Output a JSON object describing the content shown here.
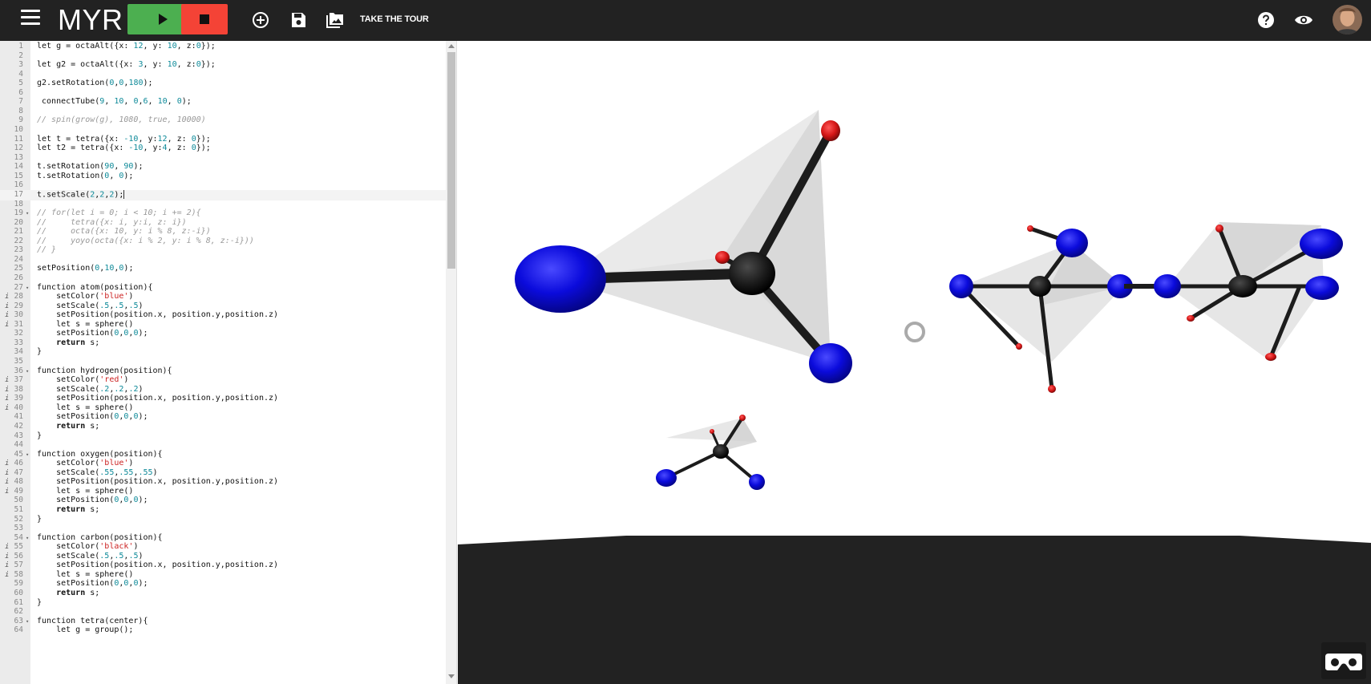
{
  "header": {
    "logo": "MYR",
    "tour_label": "TAKE THE TOUR",
    "icons": [
      "menu-icon",
      "play-icon",
      "stop-icon",
      "add-circle-icon",
      "save-icon",
      "collection-icon",
      "help-icon",
      "eye-icon",
      "avatar"
    ]
  },
  "editor": {
    "lines": [
      {
        "n": "1",
        "ann": "",
        "fold": "",
        "tokens": [
          [
            "let g = octaAlt({x: ",
            ""
          ],
          [
            "12",
            "num"
          ],
          [
            ", y: ",
            ""
          ],
          [
            "10",
            "num"
          ],
          [
            ", z:",
            ""
          ],
          [
            "0",
            "num"
          ],
          [
            "});",
            ""
          ]
        ]
      },
      {
        "n": "2",
        "ann": "",
        "fold": "",
        "tokens": []
      },
      {
        "n": "3",
        "ann": "",
        "fold": "",
        "tokens": [
          [
            "let g2 = octaAlt({x: ",
            ""
          ],
          [
            "3",
            "num"
          ],
          [
            ", y: ",
            ""
          ],
          [
            "10",
            "num"
          ],
          [
            ", z:",
            ""
          ],
          [
            "0",
            "num"
          ],
          [
            "});",
            ""
          ]
        ]
      },
      {
        "n": "4",
        "ann": "",
        "fold": "",
        "tokens": []
      },
      {
        "n": "5",
        "ann": "",
        "fold": "",
        "tokens": [
          [
            "g2.setRotation(",
            ""
          ],
          [
            "0",
            "num"
          ],
          [
            ",",
            ""
          ],
          [
            "0",
            "num"
          ],
          [
            ",",
            ""
          ],
          [
            "180",
            "num"
          ],
          [
            ");",
            ""
          ]
        ]
      },
      {
        "n": "6",
        "ann": "",
        "fold": "",
        "tokens": []
      },
      {
        "n": "7",
        "ann": "",
        "fold": "",
        "tokens": [
          [
            " connectTube(",
            ""
          ],
          [
            "9",
            "num"
          ],
          [
            ", ",
            ""
          ],
          [
            "10",
            "num"
          ],
          [
            ", ",
            ""
          ],
          [
            "0",
            "num"
          ],
          [
            ",",
            ""
          ],
          [
            "6",
            "num"
          ],
          [
            ", ",
            ""
          ],
          [
            "10",
            "num"
          ],
          [
            ", ",
            ""
          ],
          [
            "0",
            "num"
          ],
          [
            ");",
            ""
          ]
        ]
      },
      {
        "n": "8",
        "ann": "",
        "fold": "",
        "tokens": []
      },
      {
        "n": "9",
        "ann": "",
        "fold": "",
        "tokens": [
          [
            "// spin(grow(g), 1080, true, 10000)",
            "com"
          ]
        ]
      },
      {
        "n": "10",
        "ann": "",
        "fold": "",
        "tokens": []
      },
      {
        "n": "11",
        "ann": "",
        "fold": "",
        "tokens": [
          [
            "let t = tetra({x: ",
            ""
          ],
          [
            "-10",
            "num"
          ],
          [
            ", y:",
            ""
          ],
          [
            "12",
            "num"
          ],
          [
            ", z: ",
            ""
          ],
          [
            "0",
            "num"
          ],
          [
            "});",
            ""
          ]
        ]
      },
      {
        "n": "12",
        "ann": "",
        "fold": "",
        "tokens": [
          [
            "let t2 = tetra({x: ",
            ""
          ],
          [
            "-10",
            "num"
          ],
          [
            ", y:",
            ""
          ],
          [
            "4",
            "num"
          ],
          [
            ", z: ",
            ""
          ],
          [
            "0",
            "num"
          ],
          [
            "});",
            ""
          ]
        ]
      },
      {
        "n": "13",
        "ann": "",
        "fold": "",
        "tokens": []
      },
      {
        "n": "14",
        "ann": "",
        "fold": "",
        "tokens": [
          [
            "t.setRotation(",
            ""
          ],
          [
            "90",
            "num"
          ],
          [
            ", ",
            ""
          ],
          [
            "90",
            "num"
          ],
          [
            ");",
            ""
          ]
        ]
      },
      {
        "n": "15",
        "ann": "",
        "fold": "",
        "tokens": [
          [
            "t.setRotation(",
            ""
          ],
          [
            "0",
            "num"
          ],
          [
            ", ",
            ""
          ],
          [
            "0",
            "num"
          ],
          [
            ");",
            ""
          ]
        ]
      },
      {
        "n": "16",
        "ann": "",
        "fold": "",
        "tokens": []
      },
      {
        "n": "17",
        "ann": "",
        "fold": "",
        "active": true,
        "tokens": [
          [
            "t.setScale(",
            ""
          ],
          [
            "2",
            "num"
          ],
          [
            ",",
            ""
          ],
          [
            "2",
            "num"
          ],
          [
            ",",
            ""
          ],
          [
            "2",
            "num"
          ],
          [
            ");",
            ""
          ]
        ]
      },
      {
        "n": "18",
        "ann": "",
        "fold": "",
        "tokens": []
      },
      {
        "n": "19",
        "ann": "",
        "fold": "▾",
        "tokens": [
          [
            "// for(let i = 0; i < 10; i += 2){",
            "com"
          ]
        ]
      },
      {
        "n": "20",
        "ann": "",
        "fold": "",
        "tokens": [
          [
            "//     tetra({x: i, y:i, z: i})",
            "com"
          ]
        ]
      },
      {
        "n": "21",
        "ann": "",
        "fold": "",
        "tokens": [
          [
            "//     octa({x: 10, y: i % 8, z:-i})",
            "com"
          ]
        ]
      },
      {
        "n": "22",
        "ann": "",
        "fold": "",
        "tokens": [
          [
            "//     yoyo(octa({x: i % 2, y: i % 8, z:-i}))",
            "com"
          ]
        ]
      },
      {
        "n": "23",
        "ann": "",
        "fold": "",
        "tokens": [
          [
            "// }",
            "com"
          ]
        ]
      },
      {
        "n": "24",
        "ann": "",
        "fold": "",
        "tokens": []
      },
      {
        "n": "25",
        "ann": "",
        "fold": "",
        "tokens": [
          [
            "setPosition(",
            ""
          ],
          [
            "0",
            "num"
          ],
          [
            ",",
            ""
          ],
          [
            "10",
            "num"
          ],
          [
            ",",
            ""
          ],
          [
            "0",
            "num"
          ],
          [
            ");",
            ""
          ]
        ]
      },
      {
        "n": "26",
        "ann": "",
        "fold": "",
        "tokens": []
      },
      {
        "n": "27",
        "ann": "",
        "fold": "▾",
        "tokens": [
          [
            "function atom(position){",
            ""
          ]
        ]
      },
      {
        "n": "28",
        "ann": "i",
        "fold": "",
        "tokens": [
          [
            "    setColor(",
            ""
          ],
          [
            "'blue'",
            "str"
          ],
          [
            ")",
            ""
          ]
        ]
      },
      {
        "n": "29",
        "ann": "i",
        "fold": "",
        "tokens": [
          [
            "    setScale(",
            ""
          ],
          [
            ".5",
            "num"
          ],
          [
            ",",
            ""
          ],
          [
            ".5",
            "num"
          ],
          [
            ",",
            ""
          ],
          [
            ".5",
            "num"
          ],
          [
            ")",
            ""
          ]
        ]
      },
      {
        "n": "30",
        "ann": "i",
        "fold": "",
        "tokens": [
          [
            "    setPosition(position.x, position.y,position.z)",
            ""
          ]
        ]
      },
      {
        "n": "31",
        "ann": "i",
        "fold": "",
        "tokens": [
          [
            "    let s = sphere()",
            ""
          ]
        ]
      },
      {
        "n": "32",
        "ann": "",
        "fold": "",
        "tokens": [
          [
            "    setPosition(",
            ""
          ],
          [
            "0",
            "num"
          ],
          [
            ",",
            ""
          ],
          [
            "0",
            "num"
          ],
          [
            ",",
            ""
          ],
          [
            "0",
            "num"
          ],
          [
            ");",
            ""
          ]
        ]
      },
      {
        "n": "33",
        "ann": "",
        "fold": "",
        "tokens": [
          [
            "    ",
            ""
          ],
          [
            "return",
            "kw"
          ],
          [
            " s;",
            ""
          ]
        ]
      },
      {
        "n": "34",
        "ann": "",
        "fold": "",
        "tokens": [
          [
            "}",
            ""
          ]
        ]
      },
      {
        "n": "35",
        "ann": "",
        "fold": "",
        "tokens": []
      },
      {
        "n": "36",
        "ann": "",
        "fold": "▾",
        "tokens": [
          [
            "function hydrogen(position){",
            ""
          ]
        ]
      },
      {
        "n": "37",
        "ann": "i",
        "fold": "",
        "tokens": [
          [
            "    setColor(",
            ""
          ],
          [
            "'red'",
            "str"
          ],
          [
            ")",
            ""
          ]
        ]
      },
      {
        "n": "38",
        "ann": "i",
        "fold": "",
        "tokens": [
          [
            "    setScale(",
            ""
          ],
          [
            ".2",
            "num"
          ],
          [
            ",",
            ""
          ],
          [
            ".2",
            "num"
          ],
          [
            ",",
            ""
          ],
          [
            ".2",
            "num"
          ],
          [
            ")",
            ""
          ]
        ]
      },
      {
        "n": "39",
        "ann": "i",
        "fold": "",
        "tokens": [
          [
            "    setPosition(position.x, position.y,position.z)",
            ""
          ]
        ]
      },
      {
        "n": "40",
        "ann": "i",
        "fold": "",
        "tokens": [
          [
            "    let s = sphere()",
            ""
          ]
        ]
      },
      {
        "n": "41",
        "ann": "",
        "fold": "",
        "tokens": [
          [
            "    setPosition(",
            ""
          ],
          [
            "0",
            "num"
          ],
          [
            ",",
            ""
          ],
          [
            "0",
            "num"
          ],
          [
            ",",
            ""
          ],
          [
            "0",
            "num"
          ],
          [
            ");",
            ""
          ]
        ]
      },
      {
        "n": "42",
        "ann": "",
        "fold": "",
        "tokens": [
          [
            "    ",
            ""
          ],
          [
            "return",
            "kw"
          ],
          [
            " s;",
            ""
          ]
        ]
      },
      {
        "n": "43",
        "ann": "",
        "fold": "",
        "tokens": [
          [
            "}",
            ""
          ]
        ]
      },
      {
        "n": "44",
        "ann": "",
        "fold": "",
        "tokens": []
      },
      {
        "n": "45",
        "ann": "",
        "fold": "▾",
        "tokens": [
          [
            "function oxygen(position){",
            ""
          ]
        ]
      },
      {
        "n": "46",
        "ann": "i",
        "fold": "",
        "tokens": [
          [
            "    setColor(",
            ""
          ],
          [
            "'blue'",
            "str"
          ],
          [
            ")",
            ""
          ]
        ]
      },
      {
        "n": "47",
        "ann": "i",
        "fold": "",
        "tokens": [
          [
            "    setScale(",
            ""
          ],
          [
            ".55",
            "num"
          ],
          [
            ",",
            ""
          ],
          [
            ".55",
            "num"
          ],
          [
            ",",
            ""
          ],
          [
            ".55",
            "num"
          ],
          [
            ")",
            ""
          ]
        ]
      },
      {
        "n": "48",
        "ann": "i",
        "fold": "",
        "tokens": [
          [
            "    setPosition(position.x, position.y,position.z)",
            ""
          ]
        ]
      },
      {
        "n": "49",
        "ann": "i",
        "fold": "",
        "tokens": [
          [
            "    let s = sphere()",
            ""
          ]
        ]
      },
      {
        "n": "50",
        "ann": "",
        "fold": "",
        "tokens": [
          [
            "    setPosition(",
            ""
          ],
          [
            "0",
            "num"
          ],
          [
            ",",
            ""
          ],
          [
            "0",
            "num"
          ],
          [
            ",",
            ""
          ],
          [
            "0",
            "num"
          ],
          [
            ");",
            ""
          ]
        ]
      },
      {
        "n": "51",
        "ann": "",
        "fold": "",
        "tokens": [
          [
            "    ",
            ""
          ],
          [
            "return",
            "kw"
          ],
          [
            " s;",
            ""
          ]
        ]
      },
      {
        "n": "52",
        "ann": "",
        "fold": "",
        "tokens": [
          [
            "}",
            ""
          ]
        ]
      },
      {
        "n": "53",
        "ann": "",
        "fold": "",
        "tokens": []
      },
      {
        "n": "54",
        "ann": "",
        "fold": "▾",
        "tokens": [
          [
            "function carbon(position){",
            ""
          ]
        ]
      },
      {
        "n": "55",
        "ann": "i",
        "fold": "",
        "tokens": [
          [
            "    setColor(",
            ""
          ],
          [
            "'black'",
            "str"
          ],
          [
            ")",
            ""
          ]
        ]
      },
      {
        "n": "56",
        "ann": "i",
        "fold": "",
        "tokens": [
          [
            "    setScale(",
            ""
          ],
          [
            ".5",
            "num"
          ],
          [
            ",",
            ""
          ],
          [
            ".5",
            "num"
          ],
          [
            ",",
            ""
          ],
          [
            ".5",
            "num"
          ],
          [
            ")",
            ""
          ]
        ]
      },
      {
        "n": "57",
        "ann": "i",
        "fold": "",
        "tokens": [
          [
            "    setPosition(position.x, position.y,position.z)",
            ""
          ]
        ]
      },
      {
        "n": "58",
        "ann": "i",
        "fold": "",
        "tokens": [
          [
            "    let s = sphere()",
            ""
          ]
        ]
      },
      {
        "n": "59",
        "ann": "",
        "fold": "",
        "tokens": [
          [
            "    setPosition(",
            ""
          ],
          [
            "0",
            "num"
          ],
          [
            ",",
            ""
          ],
          [
            "0",
            "num"
          ],
          [
            ",",
            ""
          ],
          [
            "0",
            "num"
          ],
          [
            ");",
            ""
          ]
        ]
      },
      {
        "n": "60",
        "ann": "",
        "fold": "",
        "tokens": [
          [
            "    ",
            ""
          ],
          [
            "return",
            "kw"
          ],
          [
            " s;",
            ""
          ]
        ]
      },
      {
        "n": "61",
        "ann": "",
        "fold": "",
        "tokens": [
          [
            "}",
            ""
          ]
        ]
      },
      {
        "n": "62",
        "ann": "",
        "fold": "",
        "tokens": []
      },
      {
        "n": "63",
        "ann": "",
        "fold": "▾",
        "tokens": [
          [
            "function tetra(center){",
            ""
          ]
        ]
      },
      {
        "n": "64",
        "ann": "",
        "fold": "",
        "tokens": [
          [
            "    let g = group();",
            ""
          ]
        ]
      }
    ]
  },
  "scene": {
    "colors": {
      "oxygen": "#0b0bdc",
      "hydrogen": "#d41616",
      "carbon": "#1c1c1c",
      "floor": "#222222",
      "sky": "#ffffff",
      "face": "#d9d9d9"
    }
  }
}
